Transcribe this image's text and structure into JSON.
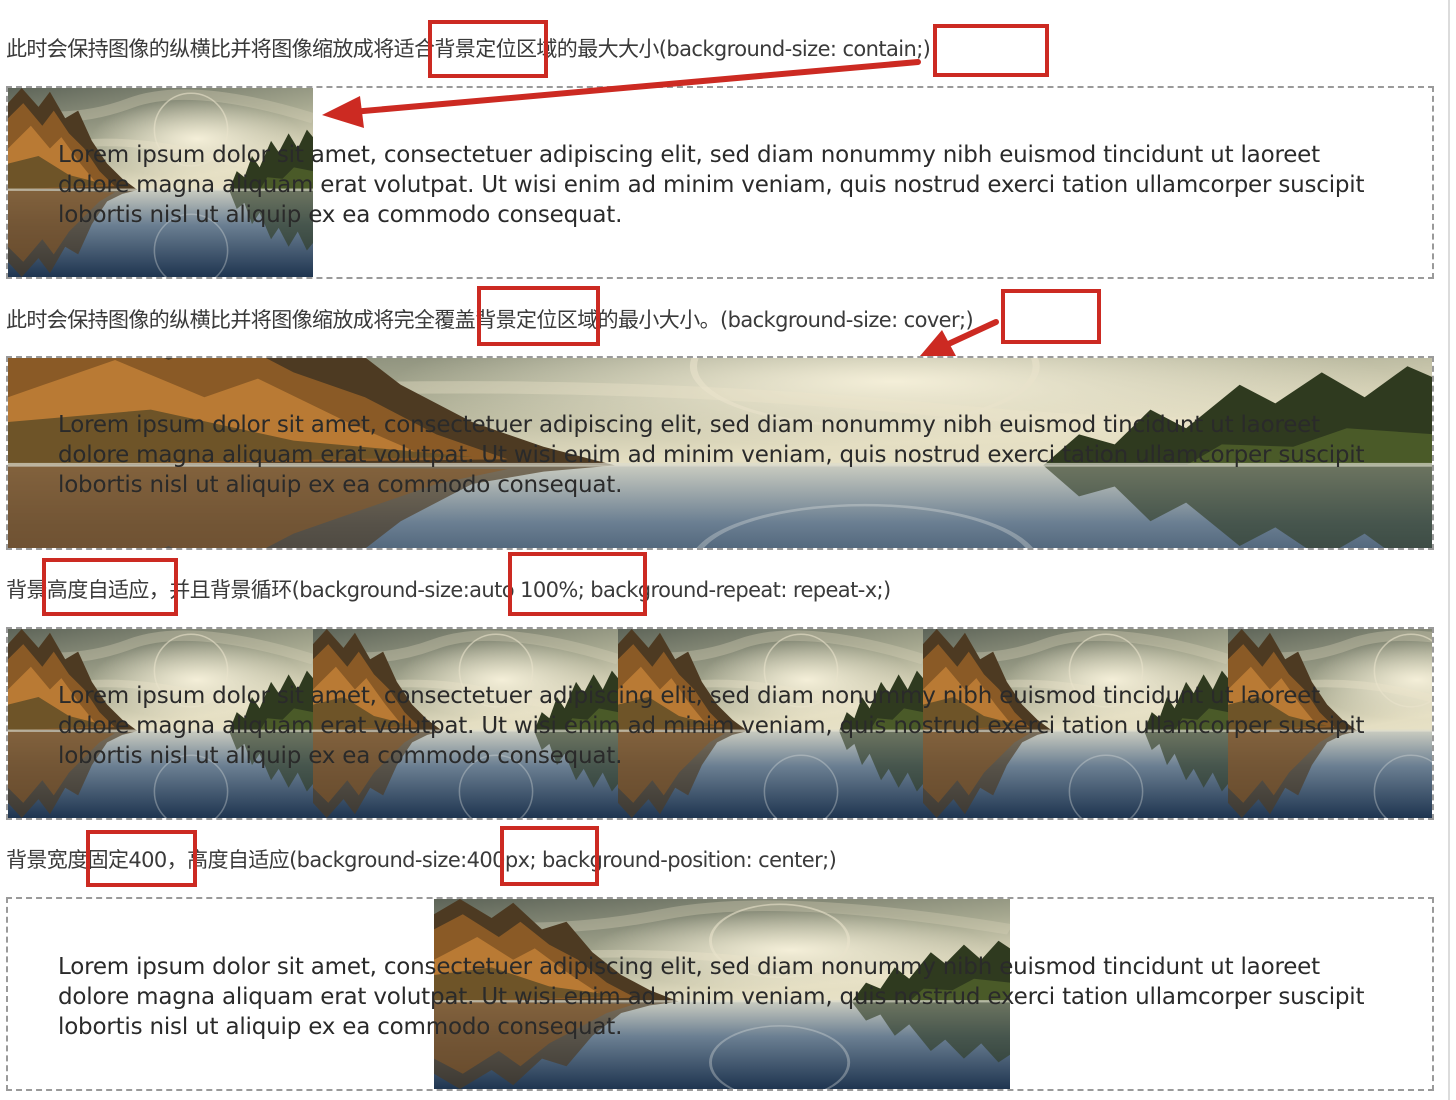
{
  "captions": {
    "contain": "此时会保持图像的纵横比并将图像缩放成将适合背景定位区域的最大大小(background-size: contain;)",
    "cover": "此时会保持图像的纵横比并将图像缩放成将完全覆盖背景定位区域的最小大小。(background-size: cover;)",
    "auto_repeat": "背景高度自适应，并且背景循环(background-size:auto 100%; background-repeat: repeat-x;)",
    "fixed_400": "背景宽度固定400，高度自适应(background-size:400px; background-position: center;)"
  },
  "lorem": "Lorem ipsum dolor sit amet, consectetuer adipiscing elit, sed diam nonummy nibh euismod tincidunt ut laoreet dolore magna aliquam erat volutpat. Ut wisi enim ad minim veniam, quis nostrud exerci tation ullamcorper suscipit lobortis nisl ut aliquip ex ea commodo consequat.",
  "image_description": "landscape-lake-forest-moon-photo",
  "colors": {
    "annotation_red": "#cc2a22",
    "dashed_border": "#9a9a9a"
  }
}
